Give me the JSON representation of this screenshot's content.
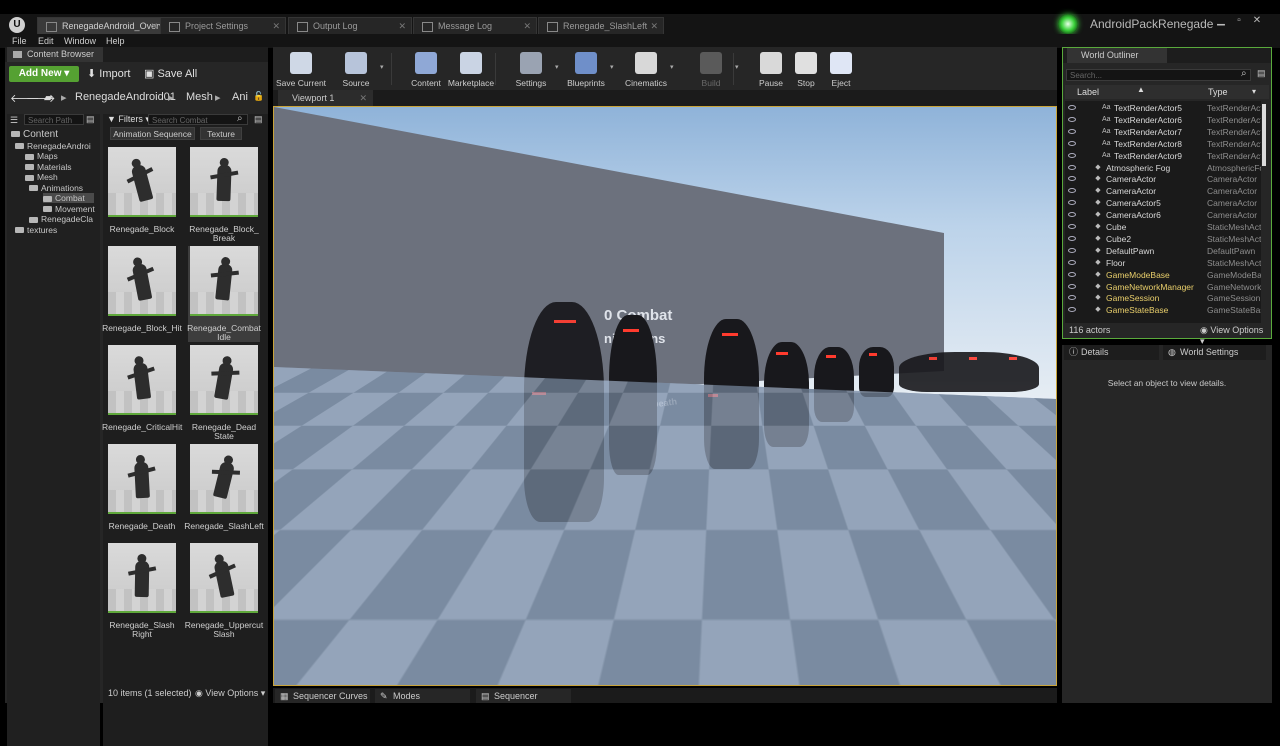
{
  "app": {
    "project_name": "AndroidPackRenegade",
    "logo_letter": "U"
  },
  "tabs": [
    {
      "label": "RenegadeAndroid_Overview",
      "active": true
    },
    {
      "label": "Project Settings",
      "active": false
    },
    {
      "label": "Output Log",
      "active": false
    },
    {
      "label": "Message Log",
      "active": false
    },
    {
      "label": "Renegade_SlashLeft",
      "active": false
    }
  ],
  "menu": [
    "File",
    "Edit",
    "Window",
    "Help"
  ],
  "content_browser": {
    "tab_label": "Content Browser",
    "add_new": "Add New",
    "import": "Import",
    "save_all": "Save All",
    "breadcrumb": [
      "RenegadeAndroid01",
      "Mesh",
      "Ani"
    ],
    "search_paths_placeholder": "Search Path",
    "filters_label": "Filters",
    "search_placeholder": "Search Combat",
    "filter_chips": [
      "Animation Sequence",
      "Texture"
    ],
    "tree": [
      {
        "label": "Content",
        "level": 0,
        "selected": false
      },
      {
        "label": "RenegadeAndroi",
        "level": 1,
        "selected": false
      },
      {
        "label": "Maps",
        "level": 2,
        "selected": false
      },
      {
        "label": "Materials",
        "level": 2,
        "selected": false
      },
      {
        "label": "Mesh",
        "level": 2,
        "selected": false
      },
      {
        "label": "Animations",
        "level": 3,
        "selected": false
      },
      {
        "label": "Combat",
        "level": 4,
        "selected": true
      },
      {
        "label": "Movement",
        "level": 4,
        "selected": false
      },
      {
        "label": "RenegadeCla",
        "level": 3,
        "selected": false
      },
      {
        "label": "textures",
        "level": 1,
        "selected": false
      }
    ],
    "assets": [
      {
        "label": "Renegade_Block"
      },
      {
        "label": "Renegade_Block_ Break"
      },
      {
        "label": "Renegade_Block_Hit"
      },
      {
        "label": "Renegade_Combat Idle"
      },
      {
        "label": "Renegade_CriticalHit"
      },
      {
        "label": "Renegade_Dead State"
      },
      {
        "label": "Renegade_Death"
      },
      {
        "label": "Renegade_SlashLeft"
      },
      {
        "label": "Renegade_Slash Right"
      },
      {
        "label": "Renegade_Uppercut Slash"
      }
    ],
    "status": "10 items (1 selected)",
    "view_options": "View Options"
  },
  "toolbar": [
    {
      "label": "Save Current",
      "enabled": true
    },
    {
      "label": "Source Control",
      "enabled": true
    },
    {
      "label": "Content",
      "enabled": true
    },
    {
      "label": "Marketplace",
      "enabled": true
    },
    {
      "label": "Settings",
      "enabled": true
    },
    {
      "label": "Blueprints",
      "enabled": true
    },
    {
      "label": "Cinematics",
      "enabled": true
    },
    {
      "label": "Build",
      "enabled": false
    },
    {
      "label": "Pause",
      "enabled": true
    },
    {
      "label": "Stop",
      "enabled": true
    },
    {
      "label": "Eject",
      "enabled": true
    }
  ],
  "viewport": {
    "tab_label": "Viewport 1",
    "wall_text_1": "0 Combat",
    "wall_text_2": "nimations",
    "floor_label": "Death"
  },
  "bottom_tabs": [
    "Sequencer Curves",
    "Modes",
    "Sequencer"
  ],
  "world_outliner": {
    "tab_label": "World Outliner",
    "search_placeholder": "Search...",
    "col_label": "Label",
    "col_type": "Type",
    "rows": [
      {
        "label": "TextRenderActor5",
        "type": "TextRenderAct",
        "indent": 1,
        "highlight": false
      },
      {
        "label": "TextRenderActor6",
        "type": "TextRenderAct",
        "indent": 1,
        "highlight": false
      },
      {
        "label": "TextRenderActor7",
        "type": "TextRenderAct",
        "indent": 1,
        "highlight": false
      },
      {
        "label": "TextRenderActor8",
        "type": "TextRenderAct",
        "indent": 1,
        "highlight": false
      },
      {
        "label": "TextRenderActor9",
        "type": "TextRenderAct",
        "indent": 1,
        "highlight": false
      },
      {
        "label": "Atmospheric Fog",
        "type": "AtmosphericFo",
        "indent": 0,
        "highlight": false
      },
      {
        "label": "CameraActor",
        "type": "CameraActor",
        "indent": 0,
        "highlight": false
      },
      {
        "label": "CameraActor",
        "type": "CameraActor",
        "indent": 0,
        "highlight": false
      },
      {
        "label": "CameraActor5",
        "type": "CameraActor",
        "indent": 0,
        "highlight": false
      },
      {
        "label": "CameraActor6",
        "type": "CameraActor",
        "indent": 0,
        "highlight": false
      },
      {
        "label": "Cube",
        "type": "StaticMeshActo",
        "indent": 0,
        "highlight": false
      },
      {
        "label": "Cube2",
        "type": "StaticMeshActo",
        "indent": 0,
        "highlight": false
      },
      {
        "label": "DefaultPawn",
        "type": "DefaultPawn",
        "indent": 0,
        "highlight": false
      },
      {
        "label": "Floor",
        "type": "StaticMeshActo",
        "indent": 0,
        "highlight": false
      },
      {
        "label": "GameModeBase",
        "type": "GameModeBase",
        "indent": 0,
        "highlight": true
      },
      {
        "label": "GameNetworkManager",
        "type": "GameNetworkM",
        "indent": 0,
        "highlight": true
      },
      {
        "label": "GameSession",
        "type": "GameSession",
        "indent": 0,
        "highlight": true
      },
      {
        "label": "GameStateBase",
        "type": "GameStateBase",
        "indent": 0,
        "highlight": true
      }
    ],
    "actor_count": "116 actors",
    "view_options": "View Options"
  },
  "details": {
    "tab_label": "Details",
    "world_settings_label": "World Settings",
    "empty_message": "Select an object to view details."
  },
  "colors": {
    "accent_green": "#55a132",
    "viewport_border": "#c9a43a",
    "highlight_yellow": "#e9cf6b"
  }
}
